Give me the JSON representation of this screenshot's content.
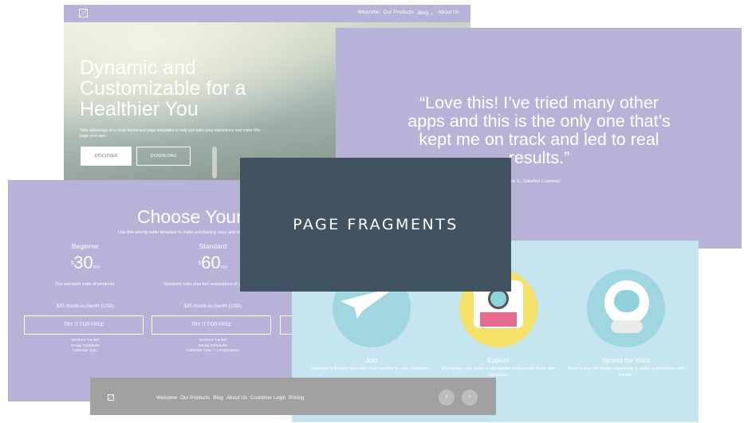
{
  "hero": {
    "nav": [
      "Welcome",
      "Our Products",
      "Blog",
      "About Us"
    ],
    "blog_caret": "⌄",
    "heading": "Dynamic and Customizable for a Healthier You",
    "subtext": "Take advantage of a clean layout and page templates to help you tailor your experience and make this page your own.",
    "discover_label": "DISCOVER",
    "download_label": "DOWNLOAD"
  },
  "quote": {
    "text": "“Love this! I’ve tried many other apps and this is the only one that’s kept me on track and led to real results.”",
    "author": "Jack S., Satisfied Customer"
  },
  "pricing": {
    "title": "Choose Your Plan",
    "subtitle": "Use this pricing table template to make purchasing easy and straightforward.",
    "plans": [
      {
        "name": "Beginner",
        "currency": "$",
        "amount": "30",
        "period": "mo",
        "description": "Our standard suite of products.",
        "billing": "$35 month-to-month (USD)",
        "cta": "TRY IT FOR FREE",
        "features": [
          "Workout Tracker",
          "Group Scheduler",
          "Calendar Sync"
        ]
      },
      {
        "name": "Standard",
        "currency": "$",
        "amount": "60",
        "period": "mo",
        "description": "Standard suite plus two expansions of your choice.",
        "billing": "$35 month-to-month (USD)",
        "cta": "TRY IT FOR FREE",
        "features": [
          "Workout Tracker",
          "Group Scheduler",
          "Calendar Sync + 2 Expansions"
        ]
      }
    ]
  },
  "features": {
    "items": [
      {
        "title": "Join",
        "description": "Highlight a feature here with clear benefits to your customers."
      },
      {
        "title": "Explore",
        "description": "Encourage your users to dig deeper and provide them with resources."
      },
      {
        "title": "Spread the Word",
        "description": "Make it easy for happy customers to share experiences with friends."
      }
    ],
    "colors": [
      "#9fd6e0",
      "#f5e06a",
      "#9fd6e0"
    ]
  },
  "footer": {
    "links": [
      "Welcome",
      "Our Products",
      "Blog",
      "About Us",
      "Customer Login",
      "Pricing"
    ],
    "social": [
      "f",
      "t"
    ]
  },
  "overlay": {
    "label": "PAGE FRAGMENTS"
  },
  "colors": {
    "lavender": "#b7b2d8",
    "sky": "#c5e6ee",
    "footer_gray": "#a1a1a1",
    "overlay": "#415260"
  }
}
